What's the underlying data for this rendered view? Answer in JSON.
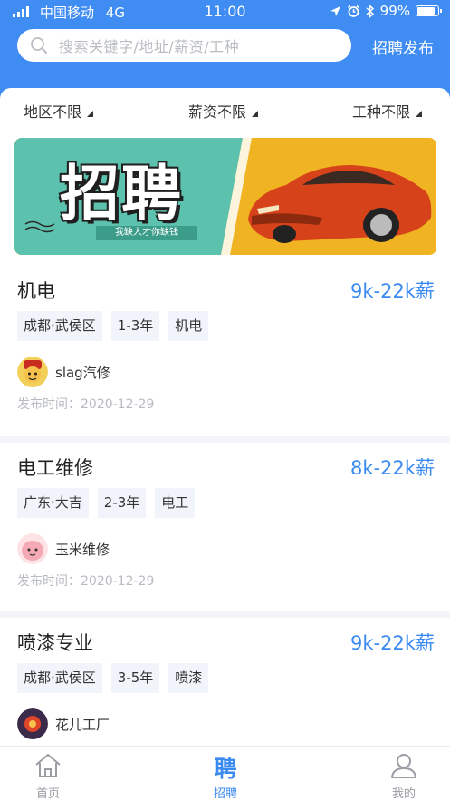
{
  "status_bar": {
    "carrier": "中国移动",
    "network": "4G",
    "time": "11:00",
    "battery": "99%"
  },
  "header": {
    "search_placeholder": "搜索关键字/地址/薪资/工种",
    "publish_label": "招聘发布"
  },
  "filters": [
    {
      "label": "地区不限"
    },
    {
      "label": "薪资不限"
    },
    {
      "label": "工种不限"
    }
  ],
  "banner": {
    "title": "招聘",
    "slogan": "我缺人才你缺钱"
  },
  "jobs": [
    {
      "title": "机电",
      "salary": "9k-22k薪",
      "tags": [
        "成都·武侯区",
        "1-3年",
        "机电"
      ],
      "company": "slag汽修",
      "date": "发布时间：2020-12-29"
    },
    {
      "title": "电工维修",
      "salary": "8k-22k薪",
      "tags": [
        "广东·大吉",
        "2-3年",
        "电工"
      ],
      "company": "玉米维修",
      "date": "发布时间：2020-12-29"
    },
    {
      "title": "喷漆专业",
      "salary": "9k-22k薪",
      "tags": [
        "成都·武侯区",
        "3-5年",
        "喷漆"
      ],
      "company": "花儿工厂",
      "date": ""
    }
  ],
  "tabbar": [
    {
      "label": "首页",
      "icon": "home-icon"
    },
    {
      "label": "招聘",
      "icon": "recruit-icon",
      "glyph": "聘"
    },
    {
      "label": "我的",
      "icon": "profile-icon"
    }
  ],
  "colors": {
    "brand": "#3f8cf2",
    "salary": "#3b8af0",
    "banner_yellow": "#f0b322",
    "banner_teal": "#5cc2ae",
    "car_red": "#d6421a"
  }
}
